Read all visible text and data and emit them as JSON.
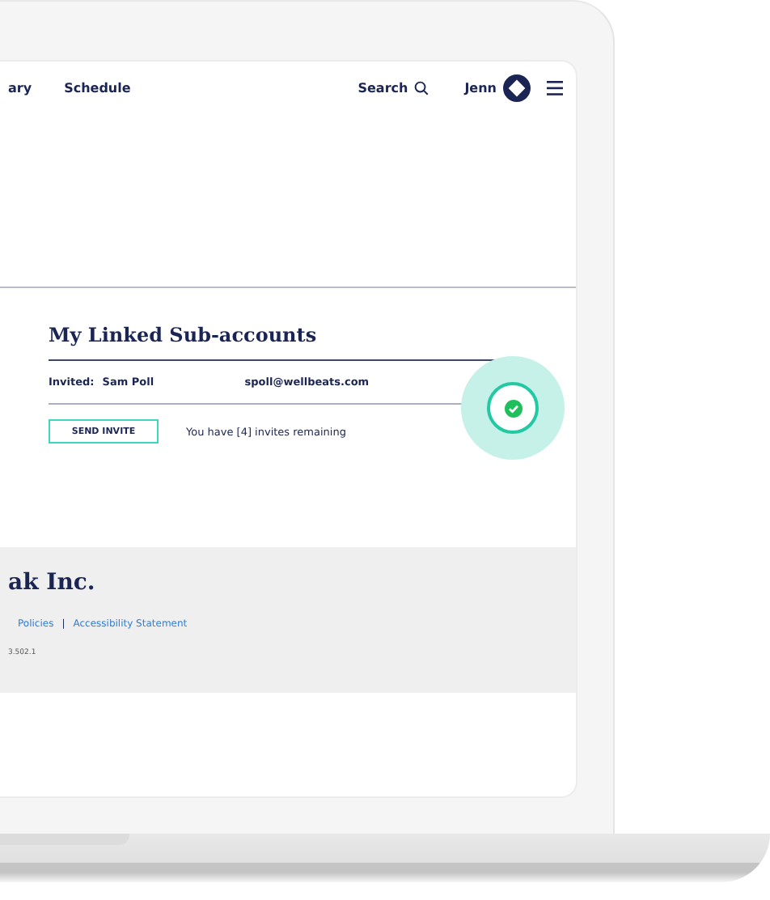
{
  "nav": {
    "links": [
      "ary",
      "Schedule"
    ],
    "search": "Search",
    "user": "Jenn"
  },
  "sub_accounts": {
    "title": "My Linked Sub-accounts",
    "invites": [
      {
        "label": "Invited:",
        "name": "Sam Poll",
        "email": "spoll@wellbeats.com",
        "confirmed": true
      }
    ],
    "button": "SEND INVITE",
    "remaining": "You have [4] invites remaining"
  },
  "footer": {
    "company": "ak Inc.",
    "links": [
      "Policies",
      "Accessibility Statement"
    ],
    "separator": "|",
    "version": "3.502.1"
  }
}
